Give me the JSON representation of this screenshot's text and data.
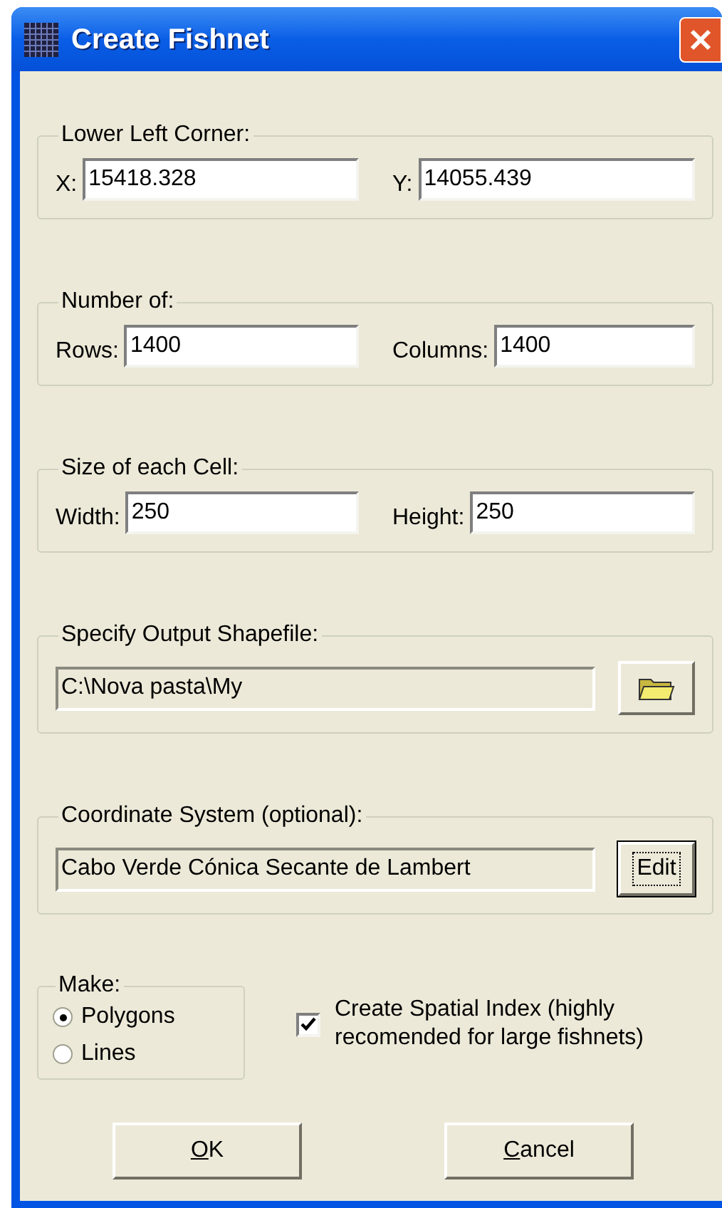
{
  "window": {
    "title": "Create Fishnet"
  },
  "sections": [
    {
      "kind": "pair",
      "label": "Lower Left Corner:",
      "fields": [
        {
          "label": "X:",
          "value": "15418.328"
        },
        {
          "label": "Y:",
          "value": "14055.439"
        }
      ]
    },
    {
      "kind": "pair",
      "label": "Number of:",
      "fields": [
        {
          "label": "Rows:",
          "value": "1400"
        },
        {
          "label": "Columns:",
          "value": "1400"
        }
      ]
    },
    {
      "kind": "pair",
      "label": "Size of each Cell:",
      "fields": [
        {
          "label": "Width:",
          "value": "250"
        },
        {
          "label": "Height:",
          "value": "250"
        }
      ]
    },
    {
      "kind": "path",
      "label": "Specify Output Shapefile:",
      "value": "C:\\Nova pasta\\My",
      "button": {
        "kind": "folder",
        "focused": false
      }
    },
    {
      "kind": "path",
      "label": "Coordinate System (optional):",
      "value": "Cabo Verde Cónica Secante de Lambert",
      "button": {
        "kind": "text",
        "label": "Edit",
        "focused": true
      }
    }
  ],
  "make": {
    "label": "Make:",
    "options": [
      {
        "label": "Polygons",
        "selected": true
      },
      {
        "label": "Lines",
        "selected": false
      }
    ]
  },
  "spatial_index": {
    "label": "Create Spatial Index (highly recomended for large fishnets)",
    "checked": true
  },
  "buttons": [
    {
      "label": "OK"
    },
    {
      "label": "Cancel"
    }
  ]
}
